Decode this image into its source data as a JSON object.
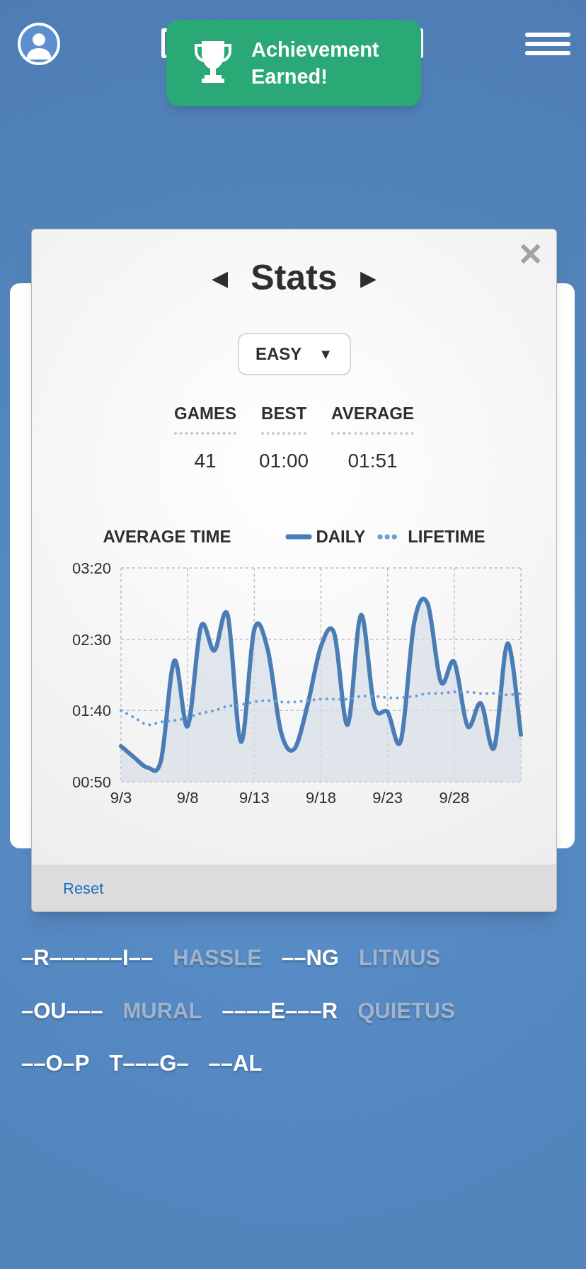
{
  "toast": {
    "title": "Achievement Earned!"
  },
  "modal": {
    "title": "Stats",
    "prev": "◀",
    "next": "▶",
    "close": "×",
    "difficulty": {
      "value": "EASY",
      "caret": "▼"
    },
    "stats": [
      {
        "label": "GAMES",
        "value": "41"
      },
      {
        "label": "BEST",
        "value": "01:00"
      },
      {
        "label": "AVERAGE",
        "value": "01:51"
      }
    ],
    "chart": {
      "chart_data": {
        "type": "area",
        "title": "AVERAGE TIME",
        "categories": [
          "9/3",
          null,
          null,
          null,
          null,
          "9/8",
          null,
          null,
          null,
          null,
          "9/13",
          null,
          null,
          null,
          null,
          "9/18",
          null,
          null,
          null,
          null,
          "9/23",
          null,
          null,
          null,
          null,
          "9/28",
          null,
          null,
          null,
          null,
          null
        ],
        "series": [
          {
            "name": "DAILY",
            "color": "#4a7db5",
            "line_style": "solid",
            "values": [
              75,
              67,
              60,
              65,
              135,
              89,
              159,
              142,
              167,
              78,
              157,
              143,
              85,
              73,
              104,
              145,
              154,
              90,
              167,
              103,
              99,
              79,
              162,
              175,
              120,
              134,
              89,
              105,
              74,
              147,
              83
            ]
          },
          {
            "name": "LIFETIME",
            "type": "line",
            "color": "#6a9fd8",
            "line_style": "dotted",
            "values": [
              100,
              95,
              90,
              92,
              93,
              95,
              98,
              100,
              103,
              104,
              106,
              107,
              106,
              106,
              107,
              108,
              108,
              108,
              110,
              110,
              109,
              109,
              110,
              112,
              112,
              113,
              113,
              112,
              112,
              111,
              112
            ]
          }
        ],
        "ylim": [
          50,
          200
        ],
        "grid": true,
        "yticks": [
          {
            "value": 50,
            "label": "00:50"
          },
          {
            "value": 100,
            "label": "01:40"
          },
          {
            "value": 150,
            "label": "02:30"
          },
          {
            "value": 200,
            "label": "03:20"
          }
        ]
      }
    },
    "footer": {
      "reset": "Reset"
    }
  },
  "word_rows": [
    [
      {
        "text": "–R––––––I––",
        "solved": false
      },
      {
        "text": "HASSLE",
        "solved": true
      },
      {
        "text": "––NG",
        "solved": false
      },
      {
        "text": "LITMUS",
        "solved": true
      }
    ],
    [
      {
        "text": "–OU–––",
        "solved": false
      },
      {
        "text": "MURAL",
        "solved": true
      },
      {
        "text": "––––E–––R",
        "solved": false
      },
      {
        "text": "QUIETUS",
        "solved": true
      }
    ],
    [
      {
        "text": "––O–P",
        "solved": false
      },
      {
        "text": "T–––G–",
        "solved": false
      },
      {
        "text": "––AL",
        "solved": false
      }
    ]
  ]
}
